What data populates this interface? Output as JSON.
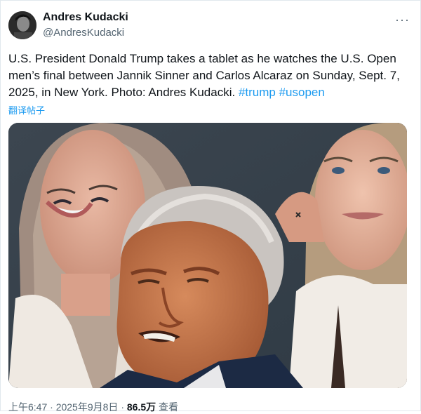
{
  "author": {
    "name": "Andres Kudacki",
    "handle": "@AndresKudacki"
  },
  "menu_icon": "more-horizontal-icon",
  "tweet": {
    "text_before": "U.S. President Donald Trump takes a tablet as he watches the U.S. Open men’s final between Jannik Sinner and Carlos Alcaraz on Sunday, Sept. 7, 2025, in New York. Photo: Andres Kudacki. ",
    "hashtags": [
      "#trump",
      "#usopen"
    ],
    "translate_label": "翻译帖子"
  },
  "meta": {
    "time": "上午6:47",
    "separator": "·",
    "date": "2025年9月8日",
    "views_count": "86.5万",
    "views_label": "查看"
  },
  "colors": {
    "link": "#1d9bf0",
    "secondary_text": "#536471",
    "text": "#0f1419"
  }
}
